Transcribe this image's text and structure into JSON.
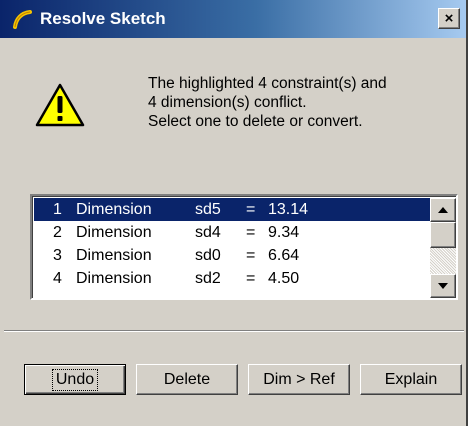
{
  "window": {
    "title": "Resolve Sketch",
    "close_label": "×"
  },
  "message": {
    "line1": "The highlighted 4 constraint(s) and",
    "line2": "4 dimension(s) conflict.",
    "line3": "Select one to delete or convert."
  },
  "list": {
    "selected_index": 0,
    "items": [
      {
        "num": "1",
        "kind": "Dimension",
        "name": "sd5",
        "eq": "=",
        "value": "13.14"
      },
      {
        "num": "2",
        "kind": "Dimension",
        "name": "sd4",
        "eq": "=",
        "value": "9.34"
      },
      {
        "num": "3",
        "kind": "Dimension",
        "name": "sd0",
        "eq": "=",
        "value": "6.64"
      },
      {
        "num": "4",
        "kind": "Dimension",
        "name": "sd2",
        "eq": "=",
        "value": "4.50"
      }
    ]
  },
  "buttons": {
    "undo": "Undo",
    "delete": "Delete",
    "dim_ref": "Dim > Ref",
    "explain": "Explain"
  },
  "colors": {
    "title_bar": "#0a246a",
    "selection": "#0a246a",
    "dialog_bg": "#d4d0c8",
    "warning_yellow": "#ffff00"
  },
  "icons": {
    "title": "sketch-arc-icon",
    "warning": "warning-triangle-icon"
  }
}
